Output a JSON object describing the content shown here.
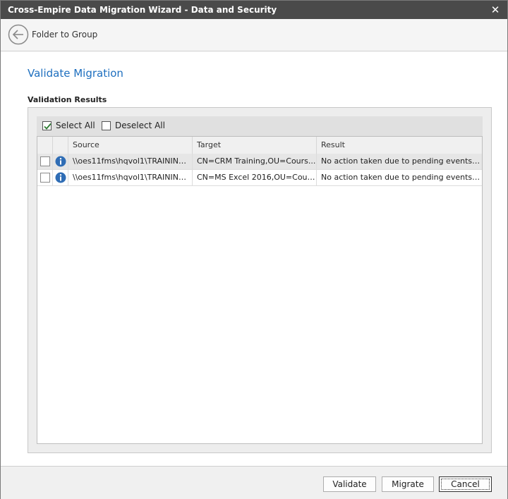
{
  "window": {
    "title": "Cross-Empire Data Migration Wizard  -  Data and Security",
    "close_glyph": "✕"
  },
  "nav": {
    "back_label": "Folder to Group"
  },
  "page": {
    "title": "Validate Migration",
    "section_label": "Validation Results"
  },
  "selection": {
    "select_all_label": "Select All",
    "select_all_checked": true,
    "deselect_all_label": "Deselect All",
    "deselect_all_checked": false
  },
  "grid": {
    "columns": [
      "Source",
      "Target",
      "Result"
    ],
    "rows": [
      {
        "checked": false,
        "status_icon": "info-icon",
        "source": "\\\\oes11fms\\hqvol1\\TRAINING\\...",
        "target": "CN=CRM Training,OU=Cours...",
        "result": "No action taken due to pending events fo...",
        "selected": true
      },
      {
        "checked": false,
        "status_icon": "info-icon",
        "source": "\\\\oes11fms\\hqvol1\\TRAINING\\...",
        "target": "CN=MS Excel 2016,OU=Cours...",
        "result": "No action taken due to pending events fo...",
        "selected": false
      }
    ]
  },
  "footer": {
    "validate_label": "Validate",
    "migrate_label": "Migrate",
    "cancel_label": "Cancel"
  },
  "colors": {
    "titlebar": "#4a4a4a",
    "accent": "#1e6fbf",
    "info_icon": "#2f6db5",
    "check": "#2e7d32"
  }
}
